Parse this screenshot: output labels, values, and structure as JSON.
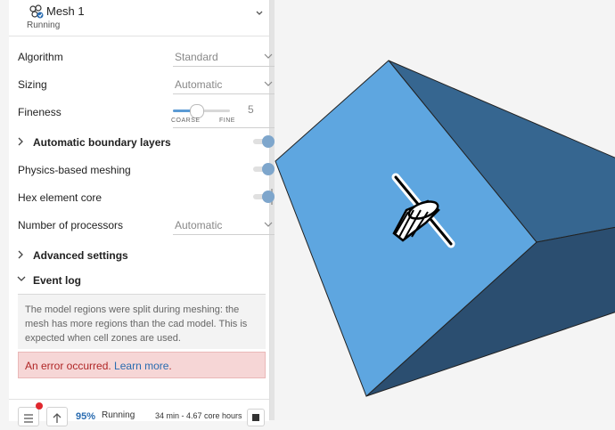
{
  "mesh": {
    "title": "Mesh 1",
    "status": "Running"
  },
  "settings": {
    "algorithm": {
      "label": "Algorithm",
      "value": "Standard"
    },
    "sizing": {
      "label": "Sizing",
      "value": "Automatic"
    },
    "fineness": {
      "label": "Fineness",
      "value": "5",
      "min_label": "COARSE",
      "max_label": "FINE",
      "level_fraction": 0.4
    },
    "boundary_layers": {
      "label": "Automatic boundary layers",
      "enabled": true
    },
    "physics_meshing": {
      "label": "Physics-based meshing",
      "enabled": true
    },
    "hex_core": {
      "label": "Hex element core",
      "enabled": true
    },
    "processors": {
      "label": "Number of processors",
      "value": "Automatic"
    }
  },
  "sections": {
    "advanced": "Advanced settings",
    "event_log": "Event log"
  },
  "event_log": {
    "message": "The model regions were split during meshing: the mesh has more regions than the cad model. This is expected when cell zones are used.",
    "error_text": "An error occurred.",
    "error_link": "Learn more",
    "error_end": "."
  },
  "footer": {
    "progress": "95%",
    "status": "Running",
    "time": "34 min - 4.67 core hours"
  },
  "colors": {
    "cube_front": "#5ea6e0",
    "cube_top": "#366690",
    "cube_side": "#2b4e70",
    "toggle_on": "#7ea6cc",
    "accent": "#2a6cb0",
    "error_bg": "#f6d6d6"
  },
  "icons": [
    "mesh-icon",
    "chevron-down-icon",
    "chevron-right-icon",
    "list-icon",
    "arrow-up-icon",
    "stop-icon",
    "rotate-gizmo-icon"
  ]
}
